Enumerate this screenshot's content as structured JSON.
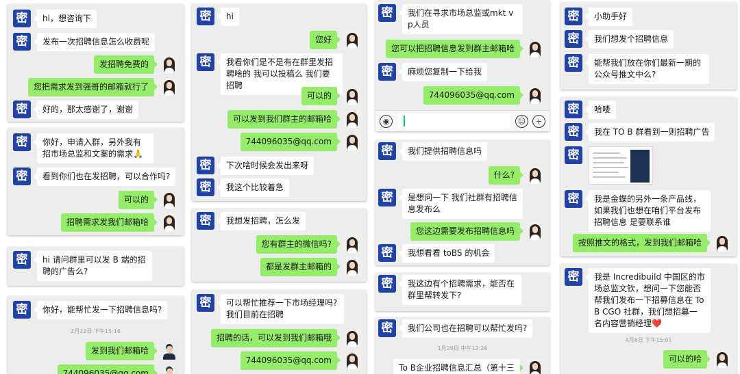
{
  "cards": [
    {
      "name": "card-1",
      "messages": [
        {
          "side": "them",
          "text": "hi，想咨询下"
        },
        {
          "side": "them",
          "text": "发布一次招聘信息怎么收费呢"
        },
        {
          "side": "me",
          "text": "发招聘免费的"
        },
        {
          "side": "me",
          "text": "您把需求发到强哥的邮箱就行了"
        },
        {
          "side": "them",
          "text": "好的，那太感谢了，谢谢"
        }
      ]
    },
    {
      "name": "card-2",
      "messages": [
        {
          "side": "them",
          "text": "你好，申请入群，另外我有招市场总监和文案的需求🙏"
        },
        {
          "side": "them",
          "text": "看到你们也在发招聘，可以合作吗?"
        },
        {
          "side": "me",
          "text": "可以的"
        },
        {
          "side": "me",
          "text": "招聘需求发我们邮箱哈"
        }
      ]
    },
    {
      "name": "card-3",
      "messages": [
        {
          "side": "them",
          "text": "hi 请问群里可以发 B 端的招聘的广告么?"
        }
      ]
    },
    {
      "name": "card-4",
      "messages": [
        {
          "side": "them",
          "text": "你好，能帮忙发一下招聘信息吗?"
        },
        {
          "kind": "time",
          "text": "2月22日 下午15:16"
        },
        {
          "side": "me",
          "text": "发到我们邮箱哈",
          "avatar": "man"
        },
        {
          "side": "me",
          "text": "744096035@qq.com",
          "avatar": "man"
        }
      ]
    },
    {
      "name": "card-5",
      "messages": [
        {
          "side": "them",
          "text": "hi"
        },
        {
          "side": "me",
          "text": "您好"
        },
        {
          "side": "them",
          "text": "我看你们是不是有在群里发招聘啥的 我可以投稿么 我们要招聘"
        },
        {
          "side": "me",
          "text": "可以的"
        },
        {
          "side": "me",
          "text": "可以发到我们群主的邮箱哈"
        },
        {
          "side": "me",
          "text": "744096035@qq.com"
        },
        {
          "side": "them",
          "text": "下次啥时候会发出来呀"
        },
        {
          "side": "them",
          "text": "我这个比较着急"
        }
      ]
    },
    {
      "name": "card-6",
      "messages": [
        {
          "side": "them",
          "text": "我想发招聘，怎么发"
        },
        {
          "side": "me",
          "text": "您有群主的微信吗?"
        },
        {
          "side": "me",
          "text": "都是发群主邮箱的"
        }
      ]
    },
    {
      "name": "card-7",
      "messages": [
        {
          "side": "them",
          "text": "可以帮忙推荐一下市场经理吗? 我们目前在招聘"
        },
        {
          "side": "me",
          "text": "招聘的话，可以发到我们邮箱哦"
        },
        {
          "side": "me",
          "text": "744096035@qq.com"
        }
      ]
    },
    {
      "name": "card-8",
      "messages": [
        {
          "side": "them",
          "text": "我们在寻求市场总监或mkt vp人员"
        },
        {
          "side": "me",
          "text": "您可以把招聘信息发到群主邮箱哈"
        },
        {
          "side": "them",
          "text": "麻烦您复制一下给我"
        },
        {
          "side": "me",
          "text": "744096035@qq.com"
        }
      ],
      "input_bar": {
        "voice_icon": "◉",
        "emoji_icon": "☺",
        "plus_icon": "+"
      }
    },
    {
      "name": "card-9",
      "messages": [
        {
          "side": "them",
          "text": "我们提供招聘信息吗"
        },
        {
          "side": "me",
          "text": "什么?"
        },
        {
          "side": "them",
          "text": "是想问一下 我们社群有招聘信息发布么"
        },
        {
          "side": "me",
          "text": "您这边需要发布招聘信息吗"
        },
        {
          "side": "them",
          "text": "我想看看 toBS 的机会"
        }
      ]
    },
    {
      "name": "card-10",
      "messages": [
        {
          "side": "them",
          "text": "我这边有个招聘需求，能否在群里帮转发下?"
        }
      ]
    },
    {
      "name": "card-11",
      "messages": [
        {
          "side": "them",
          "text": "我们公司也在招聘可以帮忙发吗?"
        },
        {
          "kind": "time",
          "text": "1月29日 中午12:26"
        },
        {
          "side": "me",
          "text": "To B企业招聘信息汇总（第十三"
        }
      ]
    },
    {
      "name": "card-12",
      "messages": [
        {
          "side": "them",
          "text": "小助手好"
        },
        {
          "side": "them",
          "text": "我们想发个招聘信息"
        },
        {
          "side": "them",
          "text": "能帮我们放在你们最新一期的公众号推文中么?"
        }
      ]
    },
    {
      "name": "card-13",
      "messages": [
        {
          "side": "them",
          "text": "哈喽"
        },
        {
          "side": "them",
          "text": "我在 TO B 群看到一则招聘广告"
        },
        {
          "side": "them",
          "kind": "image"
        },
        {
          "side": "them",
          "text": "我是金蝶的另外一条产品线，如果我们也想在咱们平台发布招聘信息 是要联系谁"
        },
        {
          "side": "me",
          "text": "按照推文的格式，发到我们邮箱哈"
        }
      ]
    },
    {
      "name": "card-14",
      "messages": [
        {
          "side": "them",
          "text": "我是 Incredibuild 中国区的市场总监文钦，想问一下您能否帮我们发布一下招募信息在 To B CGO 社群，我们想招募一名内容营销经理❤️"
        },
        {
          "kind": "time",
          "text": "4月6日 下午15:01"
        },
        {
          "side": "me",
          "text": "可以的哈"
        }
      ]
    }
  ],
  "avatars": {
    "chat_partner_glyph": "密"
  }
}
